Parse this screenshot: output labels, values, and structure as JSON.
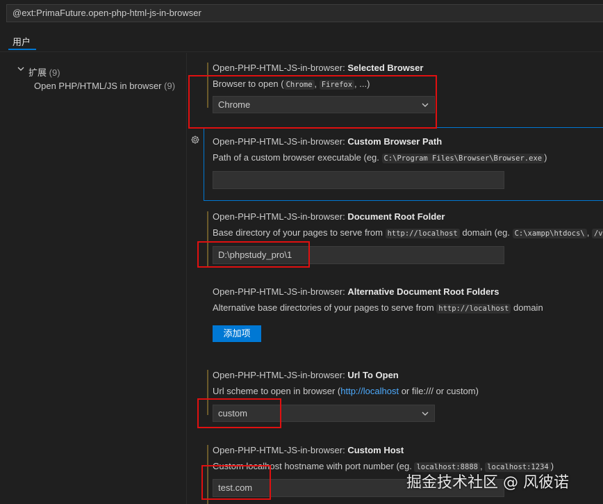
{
  "search": {
    "value": "@ext:PrimaFuture.open-php-html-js-in-browser"
  },
  "tabs": [
    {
      "label": "用户"
    }
  ],
  "tree": {
    "group": {
      "label": "扩展",
      "count": "(9)"
    },
    "child": {
      "label": "Open PHP/HTML/JS in browser",
      "count": "(9)"
    }
  },
  "settings": {
    "prefix": "Open-PHP-HTML-JS-in-browser: ",
    "selected_browser": {
      "name": "Selected Browser",
      "desc_pre": "Browser to open (",
      "code1": "Chrome",
      "sep1": ", ",
      "code2": "Firefox",
      "desc_post": ", ...)",
      "value": "Chrome"
    },
    "custom_browser_path": {
      "name": "Custom Browser Path",
      "desc_pre": "Path of a custom browser executable (eg. ",
      "code1": "C:\\Program Files\\Browser\\Browser.exe",
      "desc_post": ")",
      "value": ""
    },
    "document_root": {
      "name": "Document Root Folder",
      "desc_pre": "Base directory of your pages to serve from ",
      "code1": "http://localhost",
      "desc_mid": " domain (eg. ",
      "code2": "C:\\xampp\\htdocs\\",
      "sep": ", ",
      "code3": "/var",
      "value": "D:\\phpstudy_pro\\1"
    },
    "alt_document_root": {
      "name": "Alternative Document Root Folders",
      "desc_pre": "Alternative base directories of your pages to serve from ",
      "code1": "http://localhost",
      "desc_post": " domain",
      "button": "添加项"
    },
    "url_to_open": {
      "name": "Url To Open",
      "desc_pre": "Url scheme to open in browser (",
      "link": "http://localhost",
      "desc_post": " or file:/// or custom)",
      "value": "custom"
    },
    "custom_host": {
      "name": "Custom Host",
      "desc_pre": "Custom localhost hostname with port number (eg. ",
      "code1": "localhost:8888",
      "sep": ", ",
      "code2": "localhost:1234",
      "desc_post": ")",
      "value": "test.com"
    }
  },
  "watermark": "掘金技术社区 @ 风彼诺",
  "colors": {
    "accent": "#0078d4",
    "highlight": "#e01010",
    "link": "#4daafc"
  }
}
